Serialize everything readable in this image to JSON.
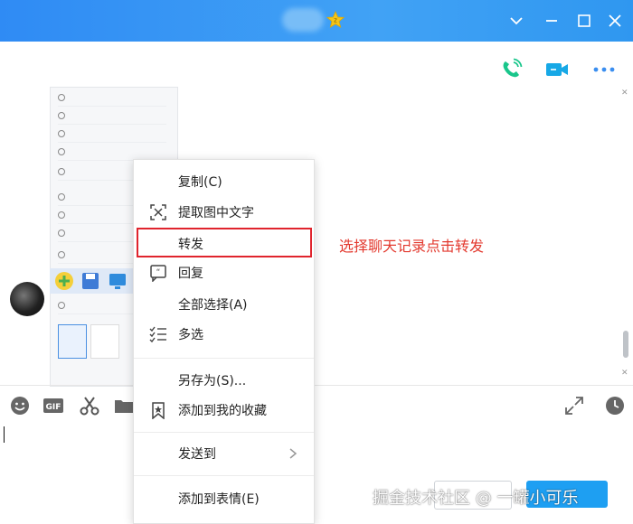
{
  "window": {
    "title_blurred": true,
    "controls": [
      "chevron-down-icon",
      "minimize-icon",
      "maximize-icon",
      "close-icon"
    ],
    "accent": "#2f8bf4"
  },
  "header": {
    "actions": [
      {
        "name": "voice-call",
        "icon": "phone-icon",
        "color": "#19c68b"
      },
      {
        "name": "video-call",
        "icon": "video-icon",
        "color": "#17a8e6"
      },
      {
        "name": "more",
        "icon": "more-icon",
        "color": "#3a8ef0"
      }
    ]
  },
  "context_menu": {
    "items": [
      {
        "label": "复制(C)",
        "icon": null
      },
      {
        "label": "提取图中文字",
        "icon": "text-extract-icon"
      },
      {
        "label": "转发",
        "icon": null,
        "highlighted": true
      },
      {
        "label": "回复",
        "icon": "quote-icon"
      },
      {
        "label": "全部选择(A)",
        "icon": null
      },
      {
        "label": "多选",
        "icon": "multi-select-icon"
      },
      {
        "label": "另存为(S)...",
        "icon": null
      },
      {
        "label": "添加到我的收藏",
        "icon": "bookmark-icon"
      },
      {
        "label": "发送到",
        "icon": null,
        "submenu": true
      },
      {
        "label": "添加到表情(E)",
        "icon": null
      }
    ],
    "highlight_color": "#e0242d"
  },
  "annotation": {
    "text": "选择聊天记录点击转发",
    "color": "#e33a2f"
  },
  "input_toolbar": {
    "tools": [
      "emoji-icon",
      "gif-icon",
      "scissors-icon",
      "folder-icon"
    ],
    "right_tools": [
      "expand-icon",
      "history-icon"
    ]
  },
  "watermark": {
    "text": "掘金技术社区 @ 一罐小可乐"
  }
}
